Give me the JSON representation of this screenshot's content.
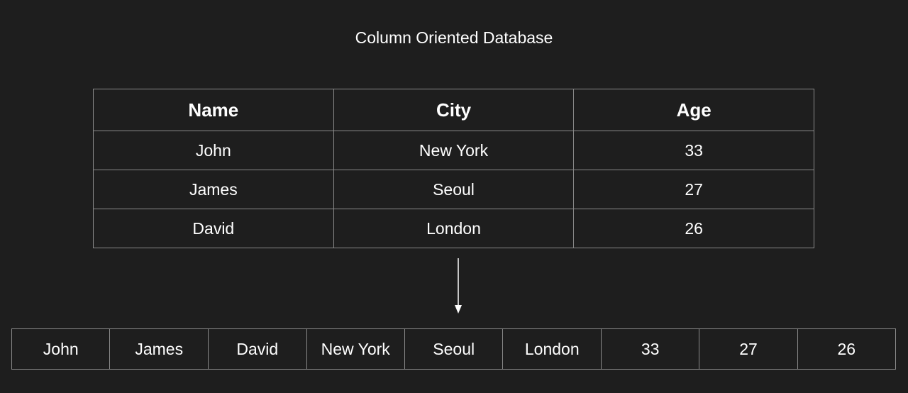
{
  "title": "Column Oriented Database",
  "table": {
    "headers": [
      "Name",
      "City",
      "Age"
    ],
    "rows": [
      [
        "John",
        "New York",
        "33"
      ],
      [
        "James",
        "Seoul",
        "27"
      ],
      [
        "David",
        "London",
        "26"
      ]
    ]
  },
  "column_storage": [
    "John",
    "James",
    "David",
    "New York",
    "Seoul",
    "London",
    "33",
    "27",
    "26"
  ],
  "colors": {
    "background": "#1e1e1e",
    "border": "#8a8a8a",
    "text": "#ffffff"
  }
}
